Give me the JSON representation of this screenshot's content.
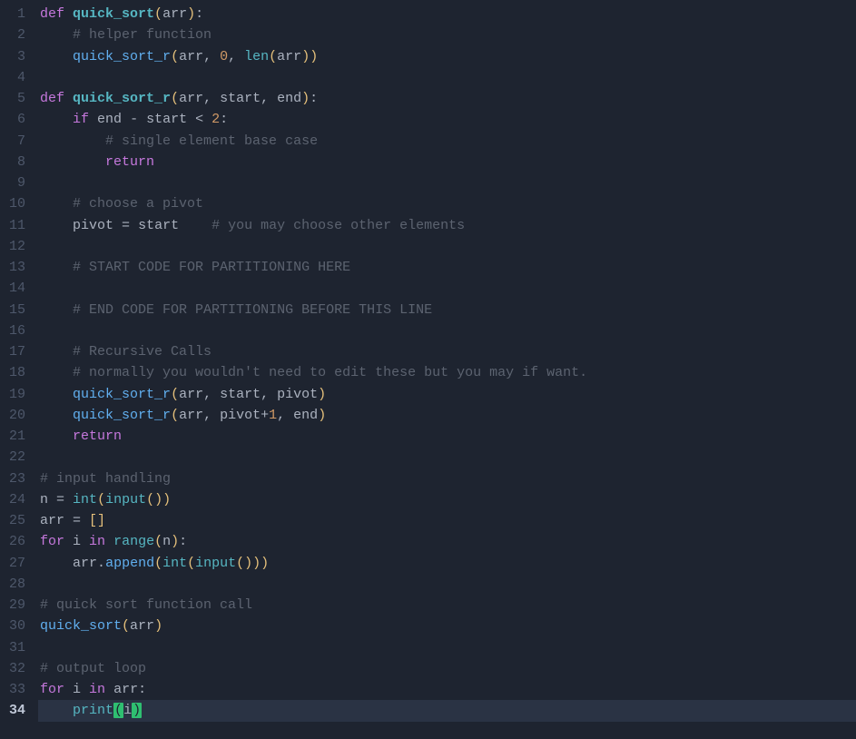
{
  "editor": {
    "active_line": 34,
    "gutter": [
      "1",
      "2",
      "3",
      "4",
      "5",
      "6",
      "7",
      "8",
      "9",
      "10",
      "11",
      "12",
      "13",
      "14",
      "15",
      "16",
      "17",
      "18",
      "19",
      "20",
      "21",
      "22",
      "23",
      "24",
      "25",
      "26",
      "27",
      "28",
      "29",
      "30",
      "31",
      "32",
      "33",
      "34"
    ],
    "lines": [
      {
        "n": 1,
        "tokens": [
          [
            "kw",
            "def "
          ],
          [
            "fn",
            "quick_sort"
          ],
          [
            "pn",
            "("
          ],
          [
            "id",
            "arr"
          ],
          [
            "pn",
            ")"
          ],
          [
            "op",
            ":"
          ]
        ]
      },
      {
        "n": 2,
        "indent": 1,
        "tokens": [
          [
            "cm",
            "# helper function"
          ]
        ]
      },
      {
        "n": 3,
        "indent": 1,
        "tokens": [
          [
            "call",
            "quick_sort_r"
          ],
          [
            "pn",
            "("
          ],
          [
            "id",
            "arr"
          ],
          [
            "op",
            ", "
          ],
          [
            "num",
            "0"
          ],
          [
            "op",
            ", "
          ],
          [
            "bi",
            "len"
          ],
          [
            "pn",
            "("
          ],
          [
            "id",
            "arr"
          ],
          [
            "pn",
            "))"
          ]
        ]
      },
      {
        "n": 4,
        "tokens": []
      },
      {
        "n": 5,
        "tokens": [
          [
            "kw",
            "def "
          ],
          [
            "fn",
            "quick_sort_r"
          ],
          [
            "pn",
            "("
          ],
          [
            "id",
            "arr"
          ],
          [
            "op",
            ", "
          ],
          [
            "id",
            "start"
          ],
          [
            "op",
            ", "
          ],
          [
            "id",
            "end"
          ],
          [
            "pn",
            ")"
          ],
          [
            "op",
            ":"
          ]
        ]
      },
      {
        "n": 6,
        "indent": 1,
        "tokens": [
          [
            "kw",
            "if "
          ],
          [
            "id",
            "end"
          ],
          [
            "op",
            " - "
          ],
          [
            "id",
            "start"
          ],
          [
            "op",
            " < "
          ],
          [
            "num",
            "2"
          ],
          [
            "op",
            ":"
          ]
        ]
      },
      {
        "n": 7,
        "indent": 2,
        "tokens": [
          [
            "cm",
            "# single element base case"
          ]
        ]
      },
      {
        "n": 8,
        "indent": 2,
        "tokens": [
          [
            "kw",
            "return"
          ]
        ]
      },
      {
        "n": 9,
        "tokens": []
      },
      {
        "n": 10,
        "indent": 1,
        "tokens": [
          [
            "cm",
            "# choose a pivot"
          ]
        ]
      },
      {
        "n": 11,
        "indent": 1,
        "tokens": [
          [
            "id",
            "pivot"
          ],
          [
            "op",
            " = "
          ],
          [
            "id",
            "start"
          ],
          [
            "id",
            "    "
          ],
          [
            "cm",
            "# you may choose other elements"
          ]
        ]
      },
      {
        "n": 12,
        "tokens": []
      },
      {
        "n": 13,
        "indent": 1,
        "tokens": [
          [
            "cm",
            "# START CODE FOR PARTITIONING HERE"
          ]
        ]
      },
      {
        "n": 14,
        "tokens": []
      },
      {
        "n": 15,
        "indent": 1,
        "tokens": [
          [
            "cm",
            "# END CODE FOR PARTITIONING BEFORE THIS LINE"
          ]
        ]
      },
      {
        "n": 16,
        "tokens": []
      },
      {
        "n": 17,
        "indent": 1,
        "tokens": [
          [
            "cm",
            "# Recursive Calls"
          ]
        ]
      },
      {
        "n": 18,
        "indent": 1,
        "tokens": [
          [
            "cm",
            "# normally you wouldn't need to edit these but you may if want."
          ]
        ]
      },
      {
        "n": 19,
        "indent": 1,
        "tokens": [
          [
            "call",
            "quick_sort_r"
          ],
          [
            "pn",
            "("
          ],
          [
            "id",
            "arr"
          ],
          [
            "op",
            ", "
          ],
          [
            "id",
            "start"
          ],
          [
            "op",
            ", "
          ],
          [
            "id",
            "pivot"
          ],
          [
            "pn",
            ")"
          ]
        ]
      },
      {
        "n": 20,
        "indent": 1,
        "tokens": [
          [
            "call",
            "quick_sort_r"
          ],
          [
            "pn",
            "("
          ],
          [
            "id",
            "arr"
          ],
          [
            "op",
            ", "
          ],
          [
            "id",
            "pivot"
          ],
          [
            "op",
            "+"
          ],
          [
            "num",
            "1"
          ],
          [
            "op",
            ", "
          ],
          [
            "id",
            "end"
          ],
          [
            "pn",
            ")"
          ]
        ]
      },
      {
        "n": 21,
        "indent": 1,
        "tokens": [
          [
            "kw",
            "return"
          ]
        ]
      },
      {
        "n": 22,
        "tokens": []
      },
      {
        "n": 23,
        "tokens": [
          [
            "cm",
            "# input handling"
          ]
        ]
      },
      {
        "n": 24,
        "tokens": [
          [
            "id",
            "n"
          ],
          [
            "op",
            " = "
          ],
          [
            "bi",
            "int"
          ],
          [
            "pn",
            "("
          ],
          [
            "bi",
            "input"
          ],
          [
            "pn",
            "())"
          ]
        ]
      },
      {
        "n": 25,
        "tokens": [
          [
            "id",
            "arr"
          ],
          [
            "op",
            " = "
          ],
          [
            "pn",
            "[]"
          ]
        ]
      },
      {
        "n": 26,
        "tokens": [
          [
            "kw",
            "for "
          ],
          [
            "id",
            "i"
          ],
          [
            "kw",
            " in "
          ],
          [
            "bi",
            "range"
          ],
          [
            "pn",
            "("
          ],
          [
            "id",
            "n"
          ],
          [
            "pn",
            ")"
          ],
          [
            "op",
            ":"
          ]
        ]
      },
      {
        "n": 27,
        "indent": 1,
        "tokens": [
          [
            "id",
            "arr"
          ],
          [
            "op",
            "."
          ],
          [
            "call",
            "append"
          ],
          [
            "pn",
            "("
          ],
          [
            "bi",
            "int"
          ],
          [
            "pn",
            "("
          ],
          [
            "bi",
            "input"
          ],
          [
            "pn",
            "()))"
          ]
        ]
      },
      {
        "n": 28,
        "tokens": []
      },
      {
        "n": 29,
        "tokens": [
          [
            "cm",
            "# quick sort function call"
          ]
        ]
      },
      {
        "n": 30,
        "tokens": [
          [
            "call",
            "quick_sort"
          ],
          [
            "pn",
            "("
          ],
          [
            "id",
            "arr"
          ],
          [
            "pn",
            ")"
          ]
        ]
      },
      {
        "n": 31,
        "tokens": []
      },
      {
        "n": 32,
        "tokens": [
          [
            "cm",
            "# output loop"
          ]
        ]
      },
      {
        "n": 33,
        "tokens": [
          [
            "kw",
            "for "
          ],
          [
            "id",
            "i"
          ],
          [
            "kw",
            " in "
          ],
          [
            "id",
            "arr"
          ],
          [
            "op",
            ":"
          ]
        ]
      },
      {
        "n": 34,
        "indent": 1,
        "tokens": [
          [
            "bi",
            "print"
          ],
          [
            "hl-paren",
            "("
          ],
          [
            "id",
            "i"
          ],
          [
            "hl-paren",
            ")"
          ]
        ]
      }
    ]
  }
}
